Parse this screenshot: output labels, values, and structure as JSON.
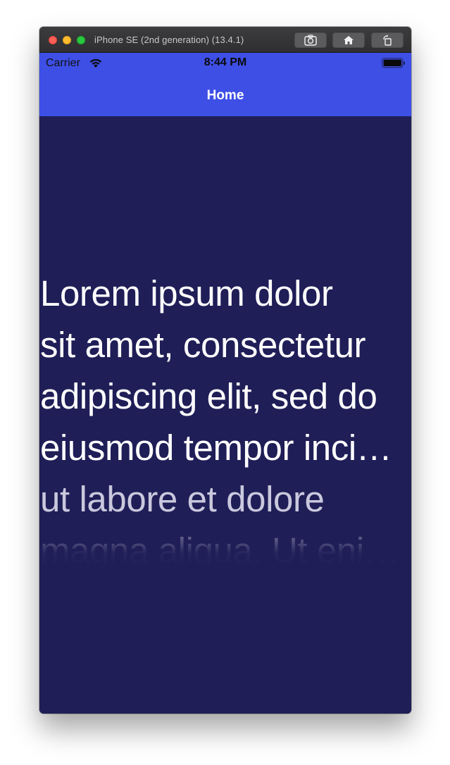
{
  "window": {
    "title": "iPhone SE (2nd generation) (13.4.1)",
    "toolbar": {
      "screenshot_icon": "camera-icon",
      "home_icon": "home-icon",
      "rotate_icon": "rotate-icon"
    }
  },
  "status_bar": {
    "carrier": "Carrier",
    "time": "8:44 PM",
    "wifi_icon": "wifi-icon",
    "battery_icon": "battery-icon"
  },
  "nav_bar": {
    "title": "Home",
    "color": "#3e4fe6"
  },
  "content": {
    "background": "#1f1e57",
    "lines": [
      "Lorem ipsum dolor",
      "sit amet, consectetur",
      "adipiscing elit, sed do",
      "eiusmod tempor inci…",
      "ut labore et dolore",
      "magna aliqua. Ut eni…"
    ]
  }
}
